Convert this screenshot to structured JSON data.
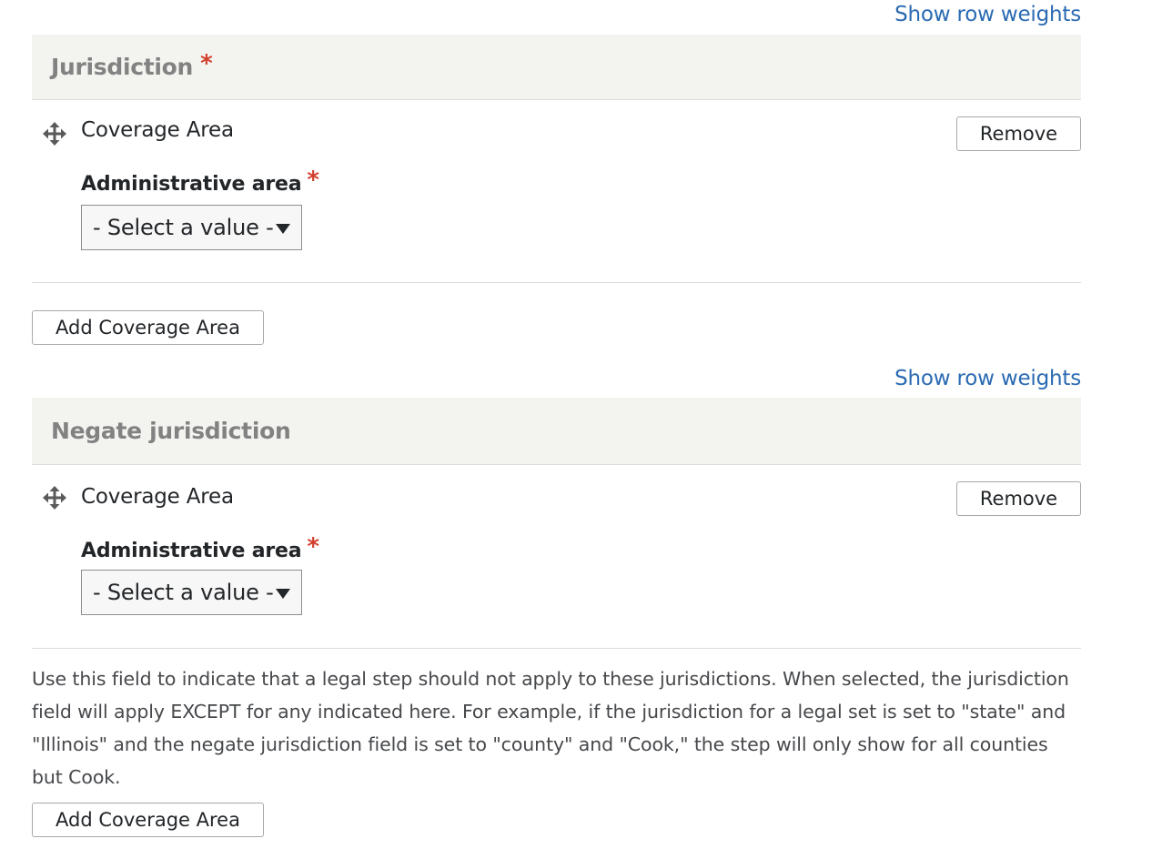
{
  "jurisdiction": {
    "show_row_weights": "Show row weights",
    "title": "Jurisdiction",
    "required_mark": "*",
    "item": {
      "label": "Coverage Area",
      "remove_label": "Remove",
      "field_label": "Administrative area",
      "field_required_mark": "*",
      "select_value": "- Select a value -"
    },
    "add_label": "Add Coverage Area"
  },
  "negate_jurisdiction": {
    "show_row_weights": "Show row weights",
    "title": "Negate jurisdiction",
    "item": {
      "label": "Coverage Area",
      "remove_label": "Remove",
      "field_label": "Administrative area",
      "field_required_mark": "*",
      "select_value": "- Select a value -"
    },
    "description": "Use this field to indicate that a legal step should not apply to these jurisdictions. When selected, the jurisdiction field will apply EXCEPT for any indicated here. For example, if the jurisdiction for a legal set is set to \"state\" and \"Illinois\" and the negate jurisdiction field is set to \"county\" and \"Cook,\" the step will only show for all counties but Cook.",
    "add_label": "Add Coverage Area"
  },
  "colors": {
    "link": "#2a6ab2",
    "required": "#d33f2d",
    "header_bg": "#f3f3f0",
    "header_text": "#828282"
  },
  "icons": {
    "drag_handle": "move-arrows-icon",
    "select_caret": "caret-down-icon"
  }
}
